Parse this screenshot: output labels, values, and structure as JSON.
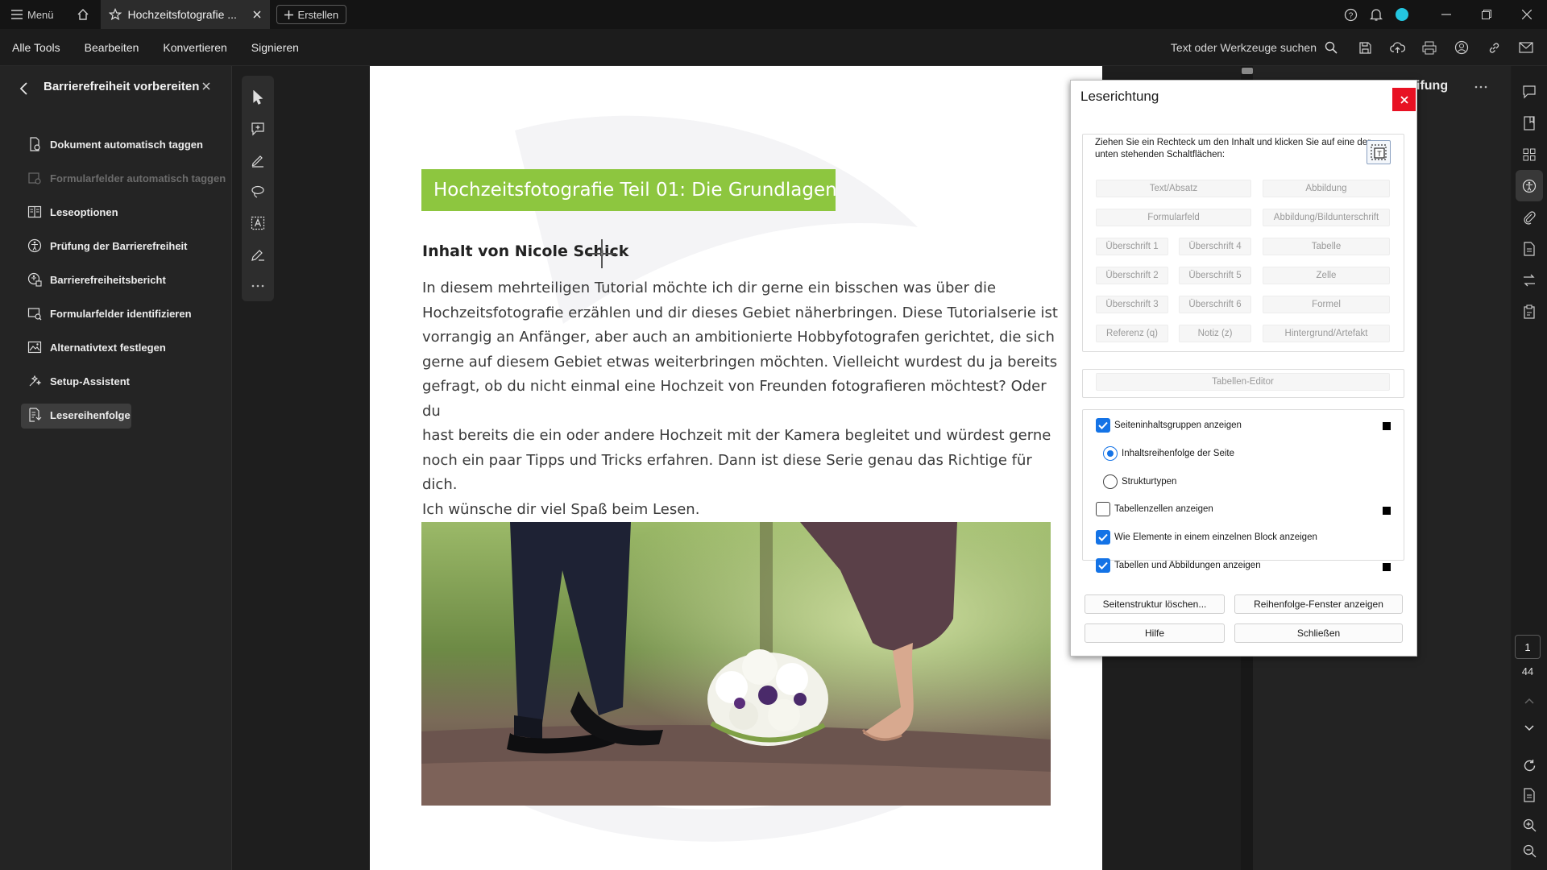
{
  "titlebar": {
    "menu_label": "Menü",
    "tab_label": "Hochzeitsfotografie ...",
    "create_label": "Erstellen",
    "accent_color": "#24c6e0"
  },
  "menubar": {
    "items": [
      "Alle Tools",
      "Bearbeiten",
      "Konvertieren",
      "Signieren"
    ],
    "search_label": "Text oder Werkzeuge suchen"
  },
  "left_panel": {
    "title": "Barrierefreiheit vorbereiten",
    "items": [
      {
        "label": "Dokument automatisch taggen",
        "icon": "doc-tag-icon",
        "state": "normal"
      },
      {
        "label": "Formularfelder automatisch taggen",
        "icon": "form-tag-icon",
        "state": "disabled"
      },
      {
        "label": "Leseoptionen",
        "icon": "reading-options-icon",
        "state": "normal"
      },
      {
        "label": "Prüfung der Barrierefreiheit",
        "icon": "accessibility-check-icon",
        "state": "normal"
      },
      {
        "label": "Barrierefreiheitsbericht",
        "icon": "accessibility-report-icon",
        "state": "normal"
      },
      {
        "label": "Formularfelder identifizieren",
        "icon": "form-identify-icon",
        "state": "normal"
      },
      {
        "label": "Alternativtext festlegen",
        "icon": "alt-text-icon",
        "state": "normal"
      },
      {
        "label": "Setup-Assistent",
        "icon": "setup-assistant-icon",
        "state": "normal"
      },
      {
        "label": "Lesereihenfolge",
        "icon": "reading-order-icon",
        "state": "active"
      }
    ]
  },
  "document": {
    "heading": "Hochzeitsfotografie Teil 01: Die Grundlagen",
    "heading_color": "#8dc63f",
    "author": "Inhalt von Nicole Schick",
    "body_lines": [
      "In diesem mehrteiligen Tutorial möchte ich dir gerne ein bisschen was über die",
      "Hochzeitsfotografie erzählen und dir dieses Gebiet näherbringen. Diese Tutorialserie ist",
      "vorrangig an Anfänger, aber auch an ambitionierte Hobbyfotografen gerichtet, die sich",
      "gerne auf diesem Gebiet etwas weiterbringen möchten. Vielleicht wurdest du ja bereits",
      "gefragt, ob du nicht einmal eine Hochzeit von Freunden fotografieren möchtest? Oder du",
      "hast bereits die ein oder andere Hochzeit mit der Kamera begleitet und würdest gerne",
      "noch ein paar Tipps und Tricks erfahren. Dann ist diese Serie genau das Richtige für dich.",
      "Ich wünsche dir viel Spaß beim Lesen."
    ]
  },
  "right_panel": {
    "title_fragment": "ifung"
  },
  "page_nav": {
    "current": "1",
    "total": "44"
  },
  "dialog": {
    "title": "Leserichtung",
    "instruction": "Ziehen Sie ein Rechteck um den Inhalt und klicken Sie auf eine der unten stehenden Schaltflächen:",
    "tag_buttons": {
      "text": "Text/Absatz",
      "figure": "Abbildung",
      "form_field": "Formularfeld",
      "figure_caption": "Abbildung/Bildunterschrift",
      "h1": "Überschrift 1",
      "h2": "Überschrift 2",
      "h3": "Überschrift 3",
      "h4": "Überschrift 4",
      "h5": "Überschrift 5",
      "h6": "Überschrift 6",
      "table": "Tabelle",
      "cell": "Zelle",
      "formula": "Formel",
      "reference": "Referenz (q)",
      "note": "Notiz (z)",
      "background": "Hintergrund/Artefakt"
    },
    "table_editor": "Tabellen-Editor",
    "options": {
      "show_groups": "Seiteninhaltsgruppen anzeigen",
      "page_order": "Inhaltsreihenfolge der Seite",
      "structure_types": "Strukturtypen",
      "show_cells": "Tabellenzellen anzeigen",
      "single_block": "Wie Elemente in einem einzelnen Block anzeigen",
      "show_tables": "Tabellen und Abbildungen anzeigen"
    },
    "buttons": {
      "clear_structure": "Seitenstruktur löschen...",
      "show_order": "Reihenfolge-Fenster anzeigen",
      "help": "Hilfe",
      "close": "Schließen"
    },
    "check_color": "#1473e6",
    "close_color": "#e81123"
  }
}
